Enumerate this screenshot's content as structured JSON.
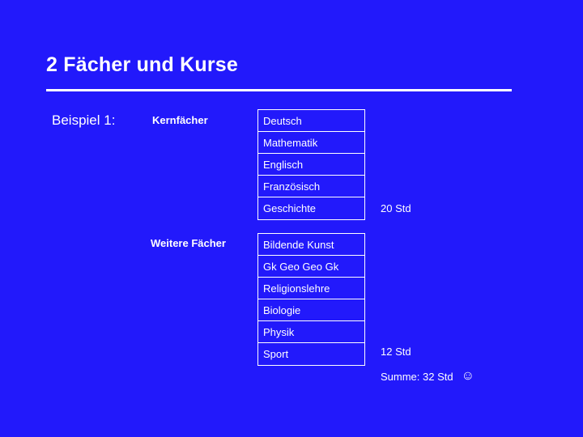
{
  "slide": {
    "title": "2  Fächer und Kurse",
    "background_color": "#2219fb",
    "text_color": "#ffffff"
  },
  "labels": {
    "example": "Beispiel 1:",
    "core_subjects": "Kernfächer",
    "further_subjects": "Weitere Fächer"
  },
  "core_table": {
    "rows": [
      {
        "subject": "Deutsch"
      },
      {
        "subject": "Mathematik"
      },
      {
        "subject": "Englisch"
      },
      {
        "subject": "Französisch"
      },
      {
        "subject": "Geschichte"
      }
    ]
  },
  "extra_table": {
    "rows": [
      {
        "subject": "Bildende Kunst"
      },
      {
        "subject": "Gk Geo Geo Gk"
      },
      {
        "subject": "Religionslehre"
      },
      {
        "subject": "Biologie"
      },
      {
        "subject": "Physik"
      },
      {
        "subject": "Sport"
      }
    ]
  },
  "hours": {
    "core": "20 Std",
    "extra": "12 Std",
    "total": "Summe: 32 Std",
    "smiley_icon": "☺"
  }
}
